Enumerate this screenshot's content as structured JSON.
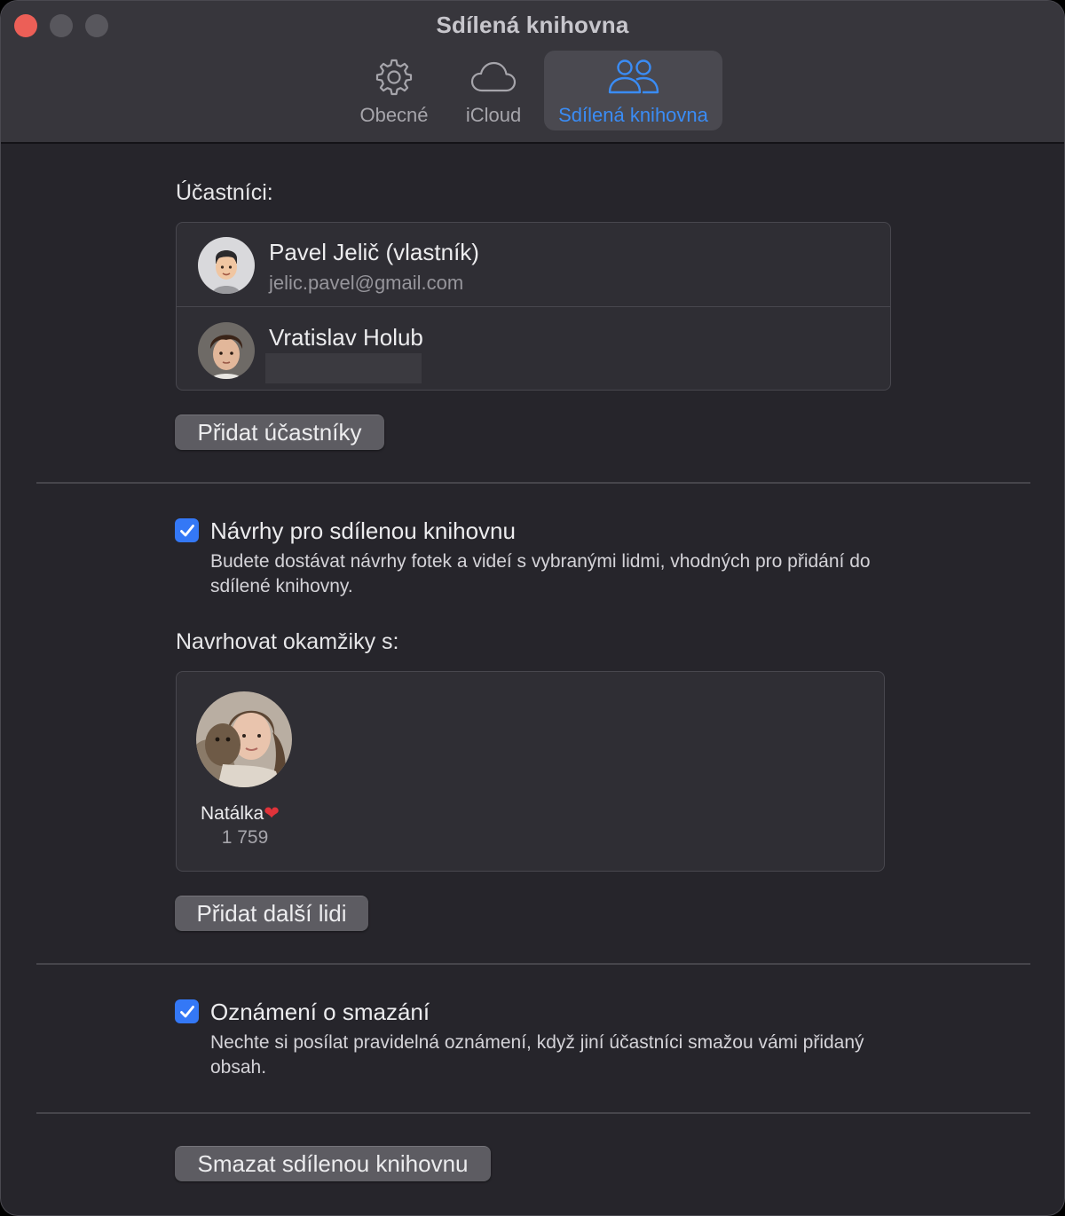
{
  "window": {
    "title": "Sdílená knihovna"
  },
  "tabs": [
    {
      "label": "Obecné",
      "icon": "gear-icon",
      "active": false
    },
    {
      "label": "iCloud",
      "icon": "cloud-icon",
      "active": false
    },
    {
      "label": "Sdílená knihovna",
      "icon": "people-icon",
      "active": true
    }
  ],
  "participants": {
    "heading": "Účastníci:",
    "list": [
      {
        "name": "Pavel Jelič (vlastník)",
        "email": "jelic.pavel@gmail.com"
      },
      {
        "name": "Vratislav Holub",
        "email": ""
      }
    ],
    "add_button": "Přidat účastníky"
  },
  "suggestions": {
    "checkbox_label": "Návrhy pro sdílenou knihovnu",
    "checked": true,
    "description": "Budete dostávat návrhy fotek a videí s vybranými lidmi, vhodných pro přidání do sdílené knihovny."
  },
  "moments": {
    "heading": "Navrhovat okamžiky s:",
    "people": [
      {
        "name": "Natálka",
        "emoji": "❤️",
        "count": "1 759"
      }
    ],
    "add_button": "Přidat další lidi"
  },
  "deletion": {
    "checkbox_label": "Oznámení o smazání",
    "checked": true,
    "description": "Nechte si posílat pravidelná oznámení, když jiní účastníci smažou vámi přidaný obsah."
  },
  "delete_button": "Smazat sdílenou knihovnu",
  "colors": {
    "accent": "#3a8cf5",
    "close": "#ec5f57",
    "window_bg": "#26252b",
    "toolbar_bg": "#37363c"
  }
}
